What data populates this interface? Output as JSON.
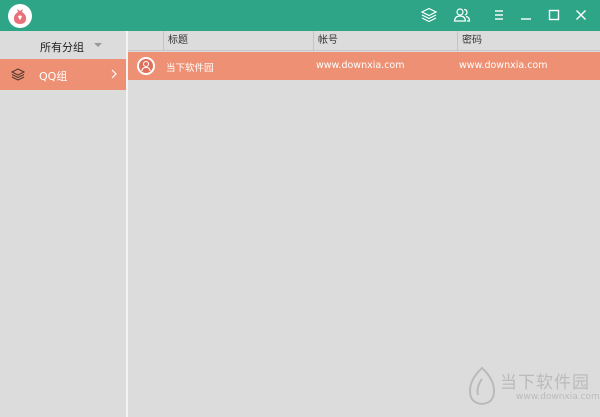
{
  "titlebar": {
    "bg_color": "#2fa588",
    "logo_icon": "money-bag-icon",
    "buttons": [
      {
        "name": "layers-button",
        "icon": "layers-icon"
      },
      {
        "name": "users-button",
        "icon": "users-icon"
      },
      {
        "name": "menu-button",
        "icon": "hamburger-icon"
      },
      {
        "name": "minimize-button",
        "icon": "minimize-icon"
      },
      {
        "name": "maximize-button",
        "icon": "maximize-icon"
      },
      {
        "name": "close-button",
        "icon": "close-icon"
      }
    ]
  },
  "sidebar": {
    "group_filter": {
      "label": "所有分组",
      "icon": "caret-down-icon"
    },
    "groups": [
      {
        "label": "QQ组",
        "icon": "layers-icon",
        "selected": true
      }
    ]
  },
  "table": {
    "columns": [
      "标题",
      "帐号",
      "密码"
    ],
    "rows": [
      {
        "title": "当下软件园",
        "account": "www.downxia.com",
        "password": "www.downxia.com",
        "icon": "user-avatar-icon",
        "selected": true
      }
    ]
  },
  "watermark": {
    "text": "当下软件园",
    "url": "www.downxia.com"
  },
  "colors": {
    "accent": "#2fa588",
    "selection": "#ed9073",
    "background": "#dcdcdc"
  }
}
